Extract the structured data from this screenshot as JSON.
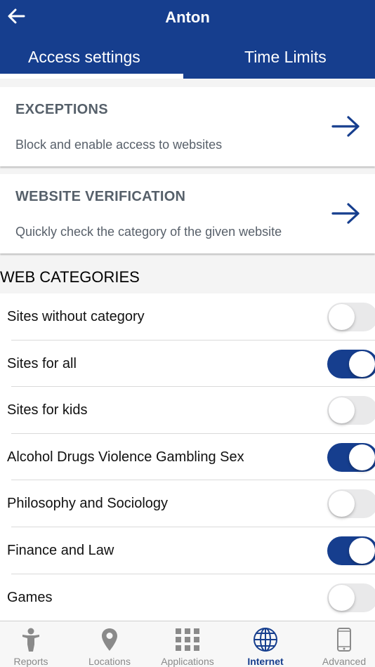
{
  "header": {
    "title": "Anton",
    "tabs": [
      {
        "label": "Access settings",
        "active": true
      },
      {
        "label": "Time Limits",
        "active": false
      }
    ]
  },
  "cards": [
    {
      "title": "EXCEPTIONS",
      "subtitle": "Block and enable access to websites"
    },
    {
      "title": "WEBSITE VERIFICATION",
      "subtitle": "Quickly check the category of the given website"
    }
  ],
  "section_title": "WEB CATEGORIES",
  "categories": [
    {
      "label": "Sites without category",
      "enabled": false
    },
    {
      "label": "Sites for all",
      "enabled": true
    },
    {
      "label": "Sites for kids",
      "enabled": false
    },
    {
      "label": "Alcohol Drugs Violence Gambling Sex",
      "enabled": true
    },
    {
      "label": "Philosophy and Sociology",
      "enabled": false
    },
    {
      "label": "Finance and Law",
      "enabled": true
    },
    {
      "label": "Games",
      "enabled": false
    }
  ],
  "tabbar": [
    {
      "label": "Reports",
      "icon": "child-figure-icon",
      "active": false
    },
    {
      "label": "Locations",
      "icon": "map-pin-icon",
      "active": false
    },
    {
      "label": "Applications",
      "icon": "grid-icon",
      "active": false
    },
    {
      "label": "Internet",
      "icon": "globe-icon",
      "active": true
    },
    {
      "label": "Advanced",
      "icon": "phone-icon",
      "active": false
    }
  ],
  "colors": {
    "brand": "#163e8e",
    "toggle_off": "#e9e9ea",
    "inactive_tab": "#8a8a8a"
  }
}
